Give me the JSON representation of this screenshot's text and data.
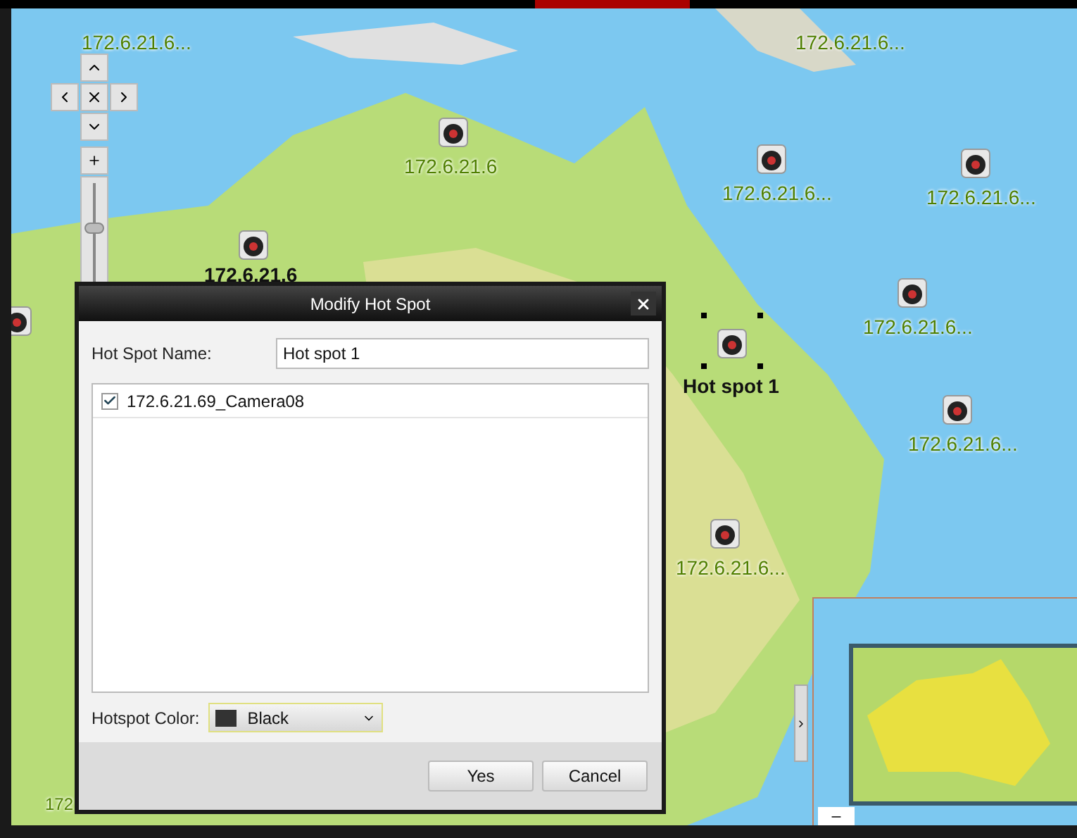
{
  "map": {
    "markers": [
      {
        "kind": "label",
        "label": "172.6.21.6...",
        "bold": false
      },
      {
        "kind": "camera",
        "label": "172.6.21.6",
        "bold": false
      },
      {
        "kind": "camera",
        "label": "172.6.21.6",
        "bold": true
      },
      {
        "kind": "camera",
        "label": "172.6.21.6...",
        "bold": false
      },
      {
        "kind": "camera",
        "label": "172.6.21.6...",
        "bold": false
      },
      {
        "kind": "camera",
        "label": "172.6.21.6...",
        "bold": false
      },
      {
        "kind": "hotspot",
        "label": "Hot spot 1",
        "bold": true
      },
      {
        "kind": "camera",
        "label": "172.6.21.6...",
        "bold": false
      },
      {
        "kind": "camera",
        "label": "172.6.21.6...",
        "bold": false
      },
      {
        "kind": "label",
        "label": "172.6.21.6...",
        "bold": false
      },
      {
        "kind": "camera"
      },
      {
        "kind": "label",
        "label": "172",
        "bold": false
      }
    ],
    "zoom": {
      "level": 0.55
    }
  },
  "dialog": {
    "title": "Modify Hot Spot",
    "name_label": "Hot Spot Name:",
    "name_value": "Hot spot 1",
    "cameras": [
      {
        "label": "172.6.21.69_Camera08",
        "checked": true
      }
    ],
    "color_label": "Hotspot Color:",
    "color_select": {
      "value": "Black",
      "color": "#333333"
    },
    "buttons": [
      "Yes",
      "Cancel"
    ]
  }
}
